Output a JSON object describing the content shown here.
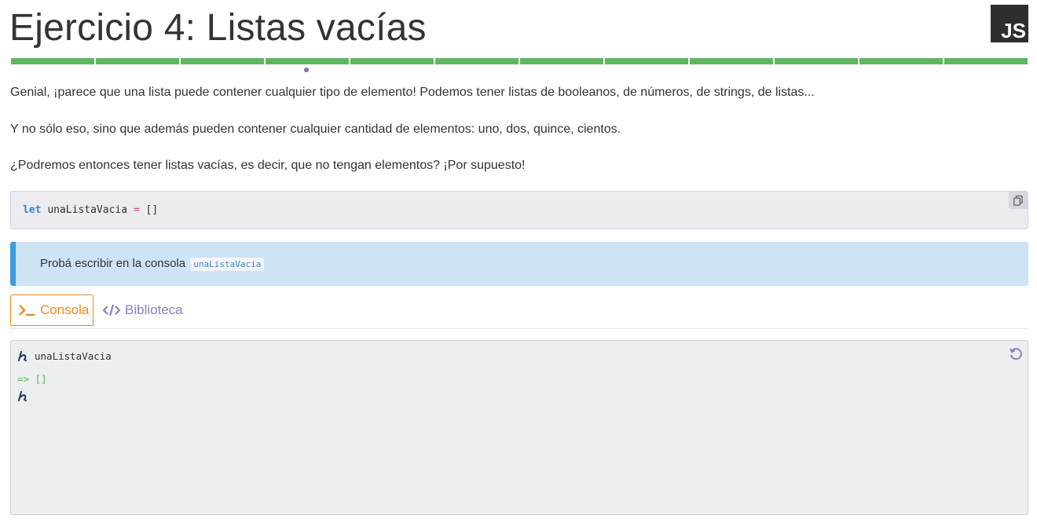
{
  "header": {
    "title": "Ejercicio 4: Listas vacías",
    "logo_text": "JS"
  },
  "progress": {
    "segments": 12,
    "current_index": 3,
    "color": "#5cb85c"
  },
  "content": {
    "paragraphs": [
      "Genial, ¡parece que una lista puede contener cualquier tipo de elemento! Podemos tener listas de booleanos, de números, de strings, de listas...",
      "Y no sólo eso, sino que además pueden contener cualquier cantidad de elementos: uno, dos, quince, cientos.",
      "¿Podremos entonces tener listas vacías, es decir, que no tengan elementos? ¡Por supuesto!"
    ],
    "code": {
      "keyword": "let",
      "identifier": "unaListaVacia",
      "operator": "=",
      "value": "[]"
    },
    "hint": {
      "text": "Probá escribir en la consola",
      "code": "unaListaVacia",
      "accent_color": "#3a9ce0"
    }
  },
  "tabs": [
    {
      "label": "Consola",
      "icon": "terminal-prompt-icon",
      "active": true,
      "color": "#f0891e"
    },
    {
      "label": "Biblioteca",
      "icon": "code-brackets-icon",
      "active": false,
      "color": "#8e7fc0"
    }
  ],
  "console": {
    "lines": [
      {
        "type": "input",
        "text": "unaListaVacia"
      },
      {
        "type": "output",
        "text": "=> []"
      },
      {
        "type": "prompt",
        "text": ""
      }
    ]
  }
}
